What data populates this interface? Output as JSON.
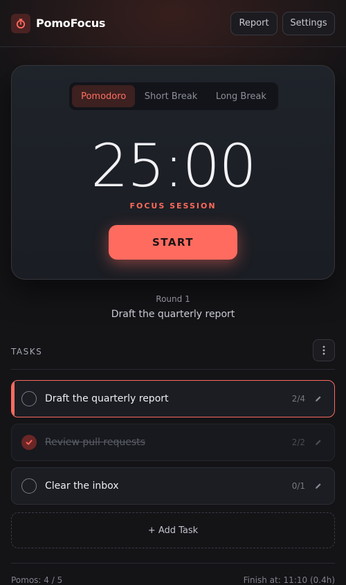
{
  "app": {
    "brand": "PomoFocus",
    "accent": "#ff6b5f"
  },
  "header": {
    "report_label": "Report",
    "settings_label": "Settings"
  },
  "timer": {
    "tabs": [
      {
        "label": "Pomodoro",
        "active": true
      },
      {
        "label": "Short Break",
        "active": false
      },
      {
        "label": "Long Break",
        "active": false
      }
    ],
    "time": "25:00",
    "session_label": "FOCUS SESSION",
    "start_label": "START"
  },
  "status": {
    "round": "Round 1",
    "current_task": "Draft the quarterly report"
  },
  "tasks": {
    "title": "TASKS",
    "items": [
      {
        "name": "Draft the quarterly report",
        "count": "2/4",
        "done": false,
        "active": true
      },
      {
        "name": "Review pull requests",
        "count": "2/2",
        "done": true,
        "active": false
      },
      {
        "name": "Clear the inbox",
        "count": "0/1",
        "done": false,
        "active": false
      }
    ],
    "add_label": "+ Add Task"
  },
  "footer": {
    "pomos": "Pomos: 4 / 5",
    "finish": "Finish at: 11:10 (0.4h)"
  }
}
